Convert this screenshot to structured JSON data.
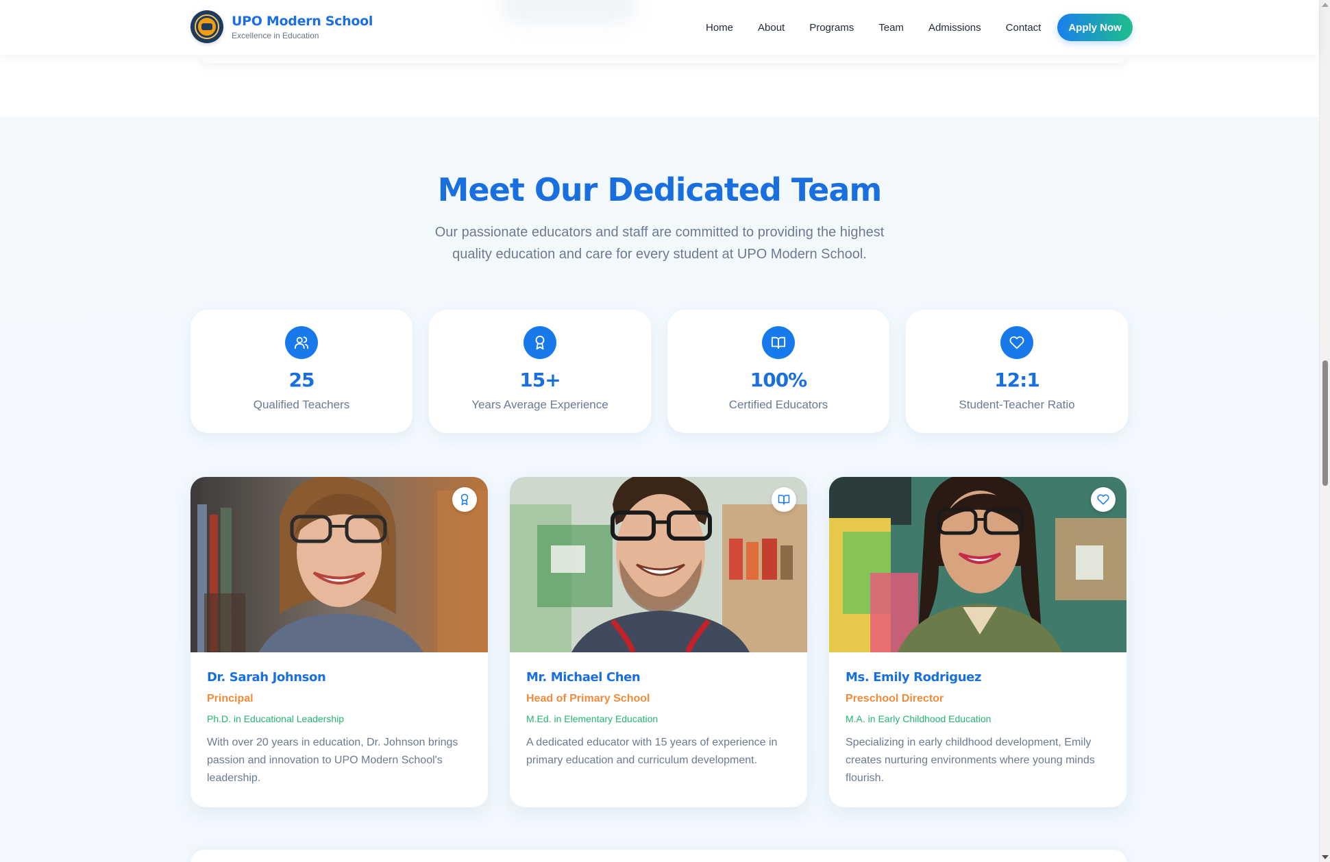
{
  "brand": {
    "title": "UPO Modern School",
    "tagline": "Excellence in Education"
  },
  "nav": {
    "items": [
      "Home",
      "About",
      "Programs",
      "Team",
      "Admissions",
      "Contact"
    ],
    "apply_label": "Apply Now"
  },
  "team": {
    "title": "Meet Our Dedicated Team",
    "subtitle_line1": "Our passionate educators and staff are committed to providing the highest",
    "subtitle_line2": "quality education and care for every student at UPO Modern School."
  },
  "stats": [
    {
      "icon": "users-icon",
      "value": "25",
      "label": "Qualified Teachers"
    },
    {
      "icon": "award-icon",
      "value": "15+",
      "label": "Years Average Experience"
    },
    {
      "icon": "book-open-icon",
      "value": "100%",
      "label": "Certified Educators"
    },
    {
      "icon": "heart-icon",
      "value": "12:1",
      "label": "Student-Teacher Ratio"
    }
  ],
  "members": [
    {
      "name": "Dr. Sarah Johnson",
      "role": "Principal",
      "degree": "Ph.D. in Educational Leadership",
      "bio": "With over 20 years in education, Dr. Johnson brings passion and innovation to UPO Modern School's leadership.",
      "badge": "award-icon"
    },
    {
      "name": "Mr. Michael Chen",
      "role": "Head of Primary School",
      "degree": "M.Ed. in Elementary Education",
      "bio": "A dedicated educator with 15 years of experience in primary education and curriculum development.",
      "badge": "book-open-icon"
    },
    {
      "name": "Ms. Emily Rodriguez",
      "role": "Preschool Director",
      "degree": "M.A. in Early Childhood Education",
      "bio": "Specializing in early childhood development, Emily creates nurturing environments where young minds flourish.",
      "badge": "heart-icon"
    }
  ],
  "colors": {
    "primary": "#1a6fdf",
    "accent_orange": "#f28a3c",
    "accent_green": "#23b56f",
    "muted_text": "#6b7a90"
  }
}
